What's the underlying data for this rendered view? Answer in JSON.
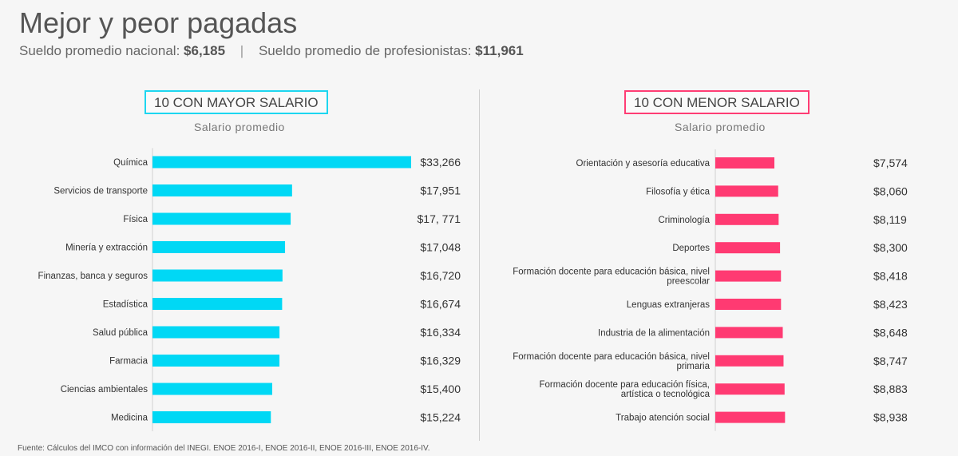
{
  "title": "Mejor y peor pagadas",
  "subtitle": {
    "national_label": "Sueldo promedio nacional:",
    "national_value": "$6,185",
    "separator": "|",
    "prof_label": "Sueldo promedio de profesionistas:",
    "prof_value": "$11,961"
  },
  "footer": "Fuente: Cálculos del IMCO con información del INEGI. ENOE 2016-I, ENOE 2016-II, ENOE 2016-III, ENOE 2016-IV.",
  "colors": {
    "top": "#00d8f5",
    "bottom": "#ff3a72",
    "top_border": "#1dd6f0",
    "bottom_border": "#ff3d74"
  },
  "chart_data": [
    {
      "type": "bar",
      "title": "10 CON MAYOR SALARIO",
      "subtitle": "Salario promedio",
      "orientation": "horizontal",
      "categories": [
        "Química",
        "Servicios de transporte",
        "Física",
        "Minería y extracción",
        "Finanzas, banca y seguros",
        "Estadística",
        "Salud pública",
        "Farmacia",
        "Ciencias ambientales",
        "Medicina"
      ],
      "values": [
        33266,
        17951,
        17771,
        17048,
        16720,
        16674,
        16334,
        16329,
        15400,
        15224
      ],
      "labels": [
        "$33,266",
        "$17,951",
        "$17, 771",
        "$17,048",
        "$16,720",
        "$16,674",
        "$16,334",
        "$16,329",
        "$15,400",
        "$15,224"
      ]
    },
    {
      "type": "bar",
      "title": "10 CON MENOR SALARIO",
      "subtitle": "Salario promedio",
      "orientation": "horizontal",
      "categories": [
        [
          "Orientación y asesoría educativa"
        ],
        [
          "Filosofía y ética"
        ],
        [
          "Criminología"
        ],
        [
          "Deportes"
        ],
        [
          "Formación docente para educación básica, nivel",
          "preescolar"
        ],
        [
          "Lenguas extranjeras"
        ],
        [
          "Industria de la alimentación"
        ],
        [
          "Formación docente para educación básica, nivel",
          "primaria"
        ],
        [
          "Formación docente para educación física,",
          "artística o tecnológica"
        ],
        [
          "Trabajo atención social"
        ]
      ],
      "values": [
        7574,
        8060,
        8119,
        8300,
        8418,
        8423,
        8648,
        8747,
        8883,
        8938
      ],
      "labels": [
        "$7,574",
        "$8,060",
        "$8,119",
        "$8,300",
        "$8,418",
        "$8,423",
        "$8,648",
        "$8,747",
        "$8,883",
        "$8,938"
      ]
    }
  ]
}
